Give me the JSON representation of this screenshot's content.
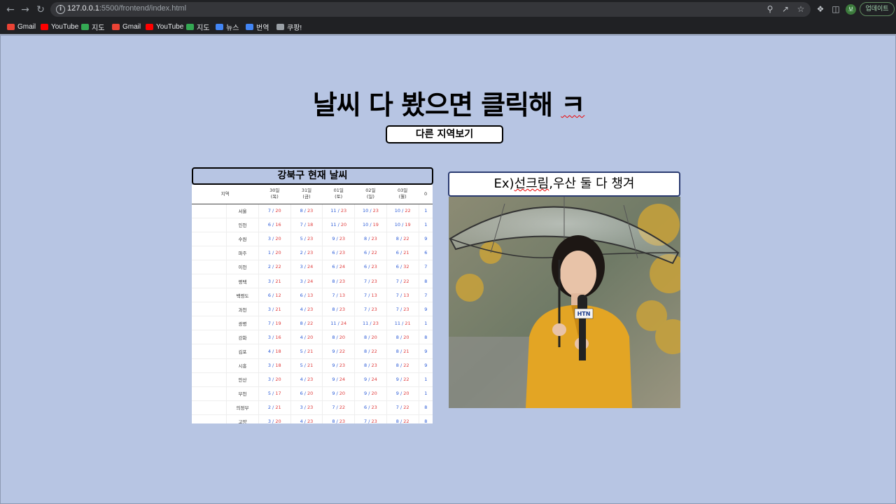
{
  "browser": {
    "url_host": "127.0.0.1",
    "url_path": ":5500/frontend/index.html",
    "update_label": "업데이트",
    "avatar_letter": "보",
    "bookmarks": [
      {
        "label": "Gmail",
        "color": "#ea4335"
      },
      {
        "label": "YouTube",
        "color": "#ff0000"
      },
      {
        "label": "지도",
        "color": "#34a853"
      },
      {
        "label": "Gmail",
        "color": "#ea4335"
      },
      {
        "label": "YouTube",
        "color": "#ff0000"
      },
      {
        "label": "지도",
        "color": "#34a853"
      },
      {
        "label": "뉴스",
        "color": "#4285f4"
      },
      {
        "label": "번역",
        "color": "#4285f4"
      },
      {
        "label": "쿠팡!",
        "color": "#9aa0a6"
      }
    ]
  },
  "page": {
    "heading_main": "날씨 다 봤으면 클릭해 ",
    "heading_tail": "ㅋ",
    "region_button": "다른 지역보기",
    "panel_title": "강북구 현재 날씨",
    "card_title_prefix": "Ex)",
    "card_title_squig": "선크림",
    "card_title_rest": ",우산 둘 다 챙겨"
  },
  "weather_table": {
    "region_header": "지역",
    "days": [
      {
        "d": "30일",
        "w": "(목)"
      },
      {
        "d": "31일",
        "w": "(금)"
      },
      {
        "d": "01일",
        "w": "(토)"
      },
      {
        "d": "02일",
        "w": "(일)"
      },
      {
        "d": "03일",
        "w": "(월)"
      },
      {
        "d": "0",
        "w": ""
      }
    ],
    "rows": [
      {
        "name": "서울",
        "vals": [
          [
            "7",
            "20"
          ],
          [
            "8",
            "23"
          ],
          [
            "11",
            "23"
          ],
          [
            "10",
            "23"
          ],
          [
            "10",
            "22"
          ],
          [
            "1",
            ""
          ]
        ]
      },
      {
        "name": "인천",
        "vals": [
          [
            "6",
            "16"
          ],
          [
            "7",
            "18"
          ],
          [
            "11",
            "20"
          ],
          [
            "10",
            "19"
          ],
          [
            "10",
            "19"
          ],
          [
            "1",
            ""
          ]
        ]
      },
      {
        "name": "수원",
        "vals": [
          [
            "3",
            "20"
          ],
          [
            "5",
            "23"
          ],
          [
            "9",
            "23"
          ],
          [
            "8",
            "23"
          ],
          [
            "8",
            "22"
          ],
          [
            "9",
            ""
          ]
        ]
      },
      {
        "name": "파주",
        "vals": [
          [
            "1",
            "20"
          ],
          [
            "2",
            "23"
          ],
          [
            "6",
            "23"
          ],
          [
            "6",
            "22"
          ],
          [
            "6",
            "21"
          ],
          [
            "6",
            ""
          ]
        ]
      },
      {
        "name": "이천",
        "vals": [
          [
            "2",
            "22"
          ],
          [
            "3",
            "24"
          ],
          [
            "6",
            "24"
          ],
          [
            "6",
            "23"
          ],
          [
            "6",
            "32"
          ],
          [
            "7",
            ""
          ]
        ]
      },
      {
        "name": "평택",
        "vals": [
          [
            "3",
            "21"
          ],
          [
            "3",
            "24"
          ],
          [
            "8",
            "23"
          ],
          [
            "7",
            "23"
          ],
          [
            "7",
            "22"
          ],
          [
            "8",
            ""
          ]
        ]
      },
      {
        "name": "백령도",
        "vals": [
          [
            "6",
            "12"
          ],
          [
            "6",
            "13"
          ],
          [
            "7",
            "13"
          ],
          [
            "7",
            "13"
          ],
          [
            "7",
            "13"
          ],
          [
            "7",
            ""
          ]
        ]
      },
      {
        "name": "과천",
        "vals": [
          [
            "3",
            "21"
          ],
          [
            "4",
            "23"
          ],
          [
            "8",
            "23"
          ],
          [
            "7",
            "23"
          ],
          [
            "7",
            "23"
          ],
          [
            "9",
            ""
          ]
        ]
      },
      {
        "name": "광명",
        "vals": [
          [
            "7",
            "19"
          ],
          [
            "8",
            "22"
          ],
          [
            "11",
            "24"
          ],
          [
            "11",
            "23"
          ],
          [
            "11",
            "21"
          ],
          [
            "1",
            ""
          ]
        ]
      },
      {
        "name": "강화",
        "vals": [
          [
            "3",
            "16"
          ],
          [
            "4",
            "20"
          ],
          [
            "8",
            "20"
          ],
          [
            "8",
            "20"
          ],
          [
            "8",
            "20"
          ],
          [
            "8",
            ""
          ]
        ]
      },
      {
        "name": "김포",
        "vals": [
          [
            "4",
            "18"
          ],
          [
            "5",
            "21"
          ],
          [
            "9",
            "22"
          ],
          [
            "8",
            "22"
          ],
          [
            "8",
            "21"
          ],
          [
            "9",
            ""
          ]
        ]
      },
      {
        "name": "시흥",
        "vals": [
          [
            "3",
            "18"
          ],
          [
            "5",
            "21"
          ],
          [
            "9",
            "23"
          ],
          [
            "8",
            "23"
          ],
          [
            "8",
            "22"
          ],
          [
            "9",
            ""
          ]
        ]
      },
      {
        "name": "안산",
        "vals": [
          [
            "3",
            "20"
          ],
          [
            "4",
            "23"
          ],
          [
            "9",
            "24"
          ],
          [
            "9",
            "24"
          ],
          [
            "9",
            "22"
          ],
          [
            "1",
            ""
          ]
        ]
      },
      {
        "name": "부천",
        "vals": [
          [
            "5",
            "17"
          ],
          [
            "6",
            "20"
          ],
          [
            "9",
            "20"
          ],
          [
            "9",
            "20"
          ],
          [
            "9",
            "20"
          ],
          [
            "1",
            ""
          ]
        ]
      },
      {
        "name": "의정부",
        "vals": [
          [
            "2",
            "21"
          ],
          [
            "3",
            "23"
          ],
          [
            "7",
            "22"
          ],
          [
            "6",
            "23"
          ],
          [
            "7",
            "22"
          ],
          [
            "8",
            ""
          ]
        ]
      },
      {
        "name": "고양",
        "vals": [
          [
            "3",
            "20"
          ],
          [
            "4",
            "23"
          ],
          [
            "8",
            "23"
          ],
          [
            "7",
            "23"
          ],
          [
            "8",
            "22"
          ],
          [
            "8",
            ""
          ]
        ]
      }
    ]
  },
  "photo": {
    "mic_label": "HTN"
  }
}
